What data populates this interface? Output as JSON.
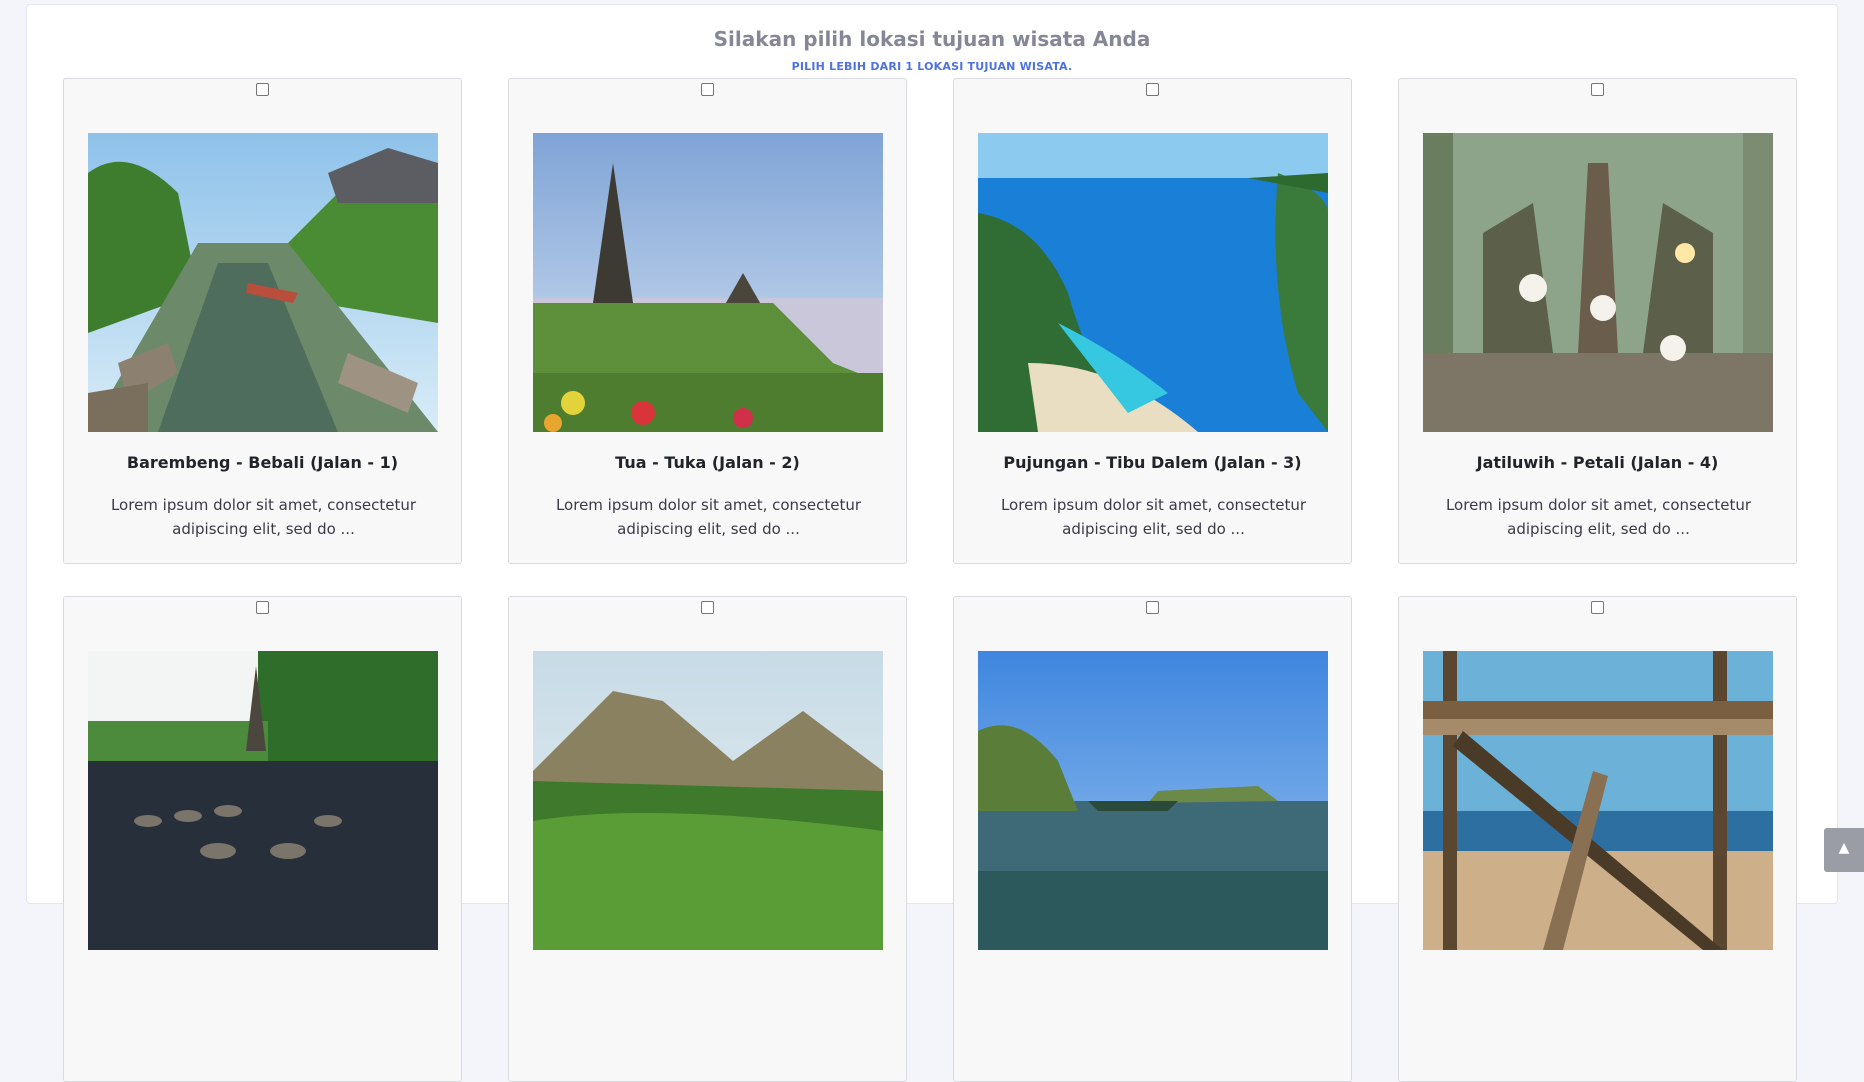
{
  "header": {
    "title": "Silakan pilih lokasi tujuan wisata Anda",
    "subtitle": "PILIH LEBIH DARI 1 LOKASI TUJUAN WISATA."
  },
  "destinations": [
    {
      "name": "Barembeng - Bebali (Jalan - 1)",
      "description": "Lorem ipsum dolor sit amet, consectetur adipiscing elit, sed do ...",
      "checked": false,
      "image": "canal-with-boats"
    },
    {
      "name": "Tua - Tuka (Jalan - 2)",
      "description": "Lorem ipsum dolor sit amet, consectetur adipiscing elit, sed do ...",
      "checked": false,
      "image": "lake-temple-pagoda"
    },
    {
      "name": "Pujungan - Tibu Dalem (Jalan - 3)",
      "description": "Lorem ipsum dolor sit amet, consectetur adipiscing elit, sed do ...",
      "checked": false,
      "image": "turquoise-bay-cliff"
    },
    {
      "name": "Jatiluwih - Petali (Jalan - 4)",
      "description": "Lorem ipsum dolor sit amet, consectetur adipiscing elit, sed do ...",
      "checked": false,
      "image": "jungle-temple-gate"
    },
    {
      "name": "",
      "description": "",
      "checked": false,
      "image": "water-palace-stepping-stones"
    },
    {
      "name": "",
      "description": "",
      "checked": false,
      "image": "twin-volcanoes-rice-fields"
    },
    {
      "name": "",
      "description": "",
      "checked": false,
      "image": "coastline-with-boats"
    },
    {
      "name": "",
      "description": "",
      "checked": false,
      "image": "bamboo-pergola-beach"
    }
  ],
  "scroll_top_icon": "chevron-up-icon"
}
